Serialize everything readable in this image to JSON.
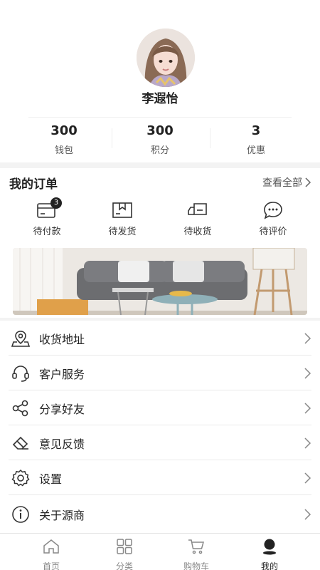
{
  "profile": {
    "username": "李遐怡",
    "stats": [
      {
        "value": "300",
        "label": "钱包"
      },
      {
        "value": "300",
        "label": "积分"
      },
      {
        "value": "3",
        "label": "优惠"
      }
    ]
  },
  "orders": {
    "title": "我的订单",
    "view_all": "查看全部",
    "items": [
      {
        "label": "待付款",
        "icon": "wallet-icon",
        "badge": "3"
      },
      {
        "label": "待发货",
        "icon": "package-icon"
      },
      {
        "label": "待收货",
        "icon": "truck-icon"
      },
      {
        "label": "待评价",
        "icon": "chat-bubble-icon"
      }
    ]
  },
  "menu": {
    "items": [
      {
        "label": "收货地址",
        "icon": "location-pin-icon"
      },
      {
        "label": "客户服务",
        "icon": "headset-icon"
      },
      {
        "label": "分享好友",
        "icon": "share-icon"
      },
      {
        "label": "意见反馈",
        "icon": "eraser-icon"
      },
      {
        "label": "设置",
        "icon": "gear-icon"
      },
      {
        "label": "关于源商",
        "icon": "info-icon"
      }
    ]
  },
  "tabbar": {
    "active": 3,
    "items": [
      {
        "label": "首页",
        "icon": "home-icon"
      },
      {
        "label": "分类",
        "icon": "grid-icon"
      },
      {
        "label": "购物车",
        "icon": "cart-icon"
      },
      {
        "label": "我的",
        "icon": "user-icon"
      }
    ]
  },
  "colors": {
    "text_primary": "#222222",
    "text_secondary": "#888888",
    "background": "#f3f3f3",
    "surface": "#ffffff"
  }
}
